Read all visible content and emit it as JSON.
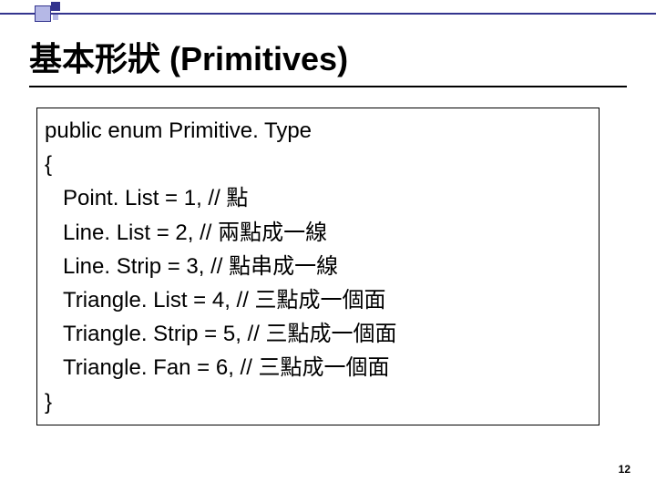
{
  "title": "基本形狀 (Primitives)",
  "code": {
    "decl": "public enum Primitive. Type",
    "open": "{",
    "lines": [
      "Point. List = 1, // 點",
      "Line. List = 2,  // 兩點成一線",
      "Line. Strip = 3, // 點串成一線",
      "Triangle. List = 4,  // 三點成一個面",
      "Triangle. Strip = 5, // 三點成一個面",
      "Triangle. Fan = 6, // 三點成一個面"
    ],
    "close": "}"
  },
  "page_number": "12"
}
